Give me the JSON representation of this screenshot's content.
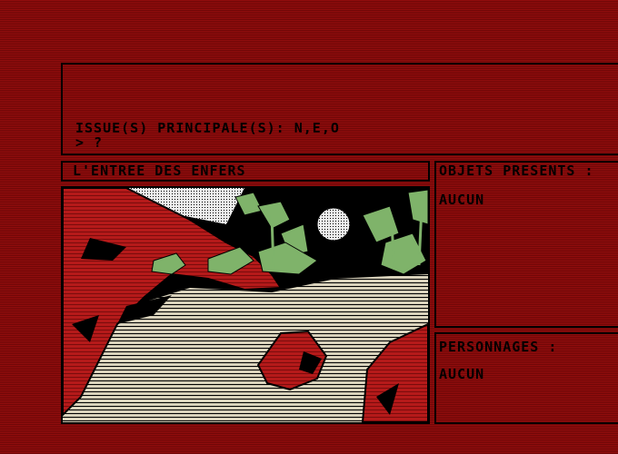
{
  "message": {
    "exits_line": "ISSUE(S) PRINCIPALE(S): N,E,O",
    "prompt": "> ?"
  },
  "location": {
    "title": "L'ENTREE DES ENFERS"
  },
  "objects_panel": {
    "header": "OBJETS PRESENTS :",
    "value": "AUCUN"
  },
  "characters_panel": {
    "header": "PERSONNAGES :",
    "value": "AUCUN"
  },
  "colors": {
    "background": "#8a0f0f",
    "border": "#000000",
    "sand": "#c9c2a9",
    "foliage": "#7fb36a",
    "rock": "#b01818"
  }
}
